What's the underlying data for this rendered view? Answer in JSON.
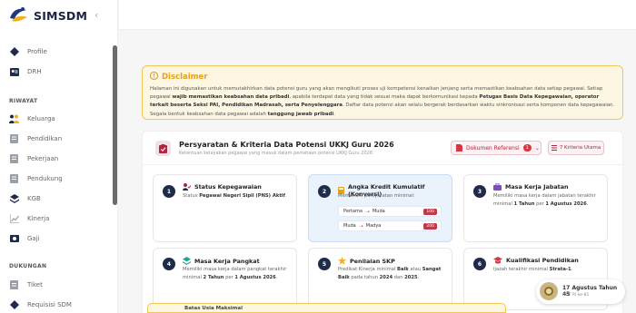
{
  "app": {
    "name": "SIMSDM"
  },
  "sidebar": {
    "items_top": [
      {
        "label": "Profile",
        "icon": "diamond-icon"
      },
      {
        "label": "DRH",
        "icon": "id-card-icon"
      }
    ],
    "section_riwayat": "RIWAYAT",
    "items_riwayat": [
      {
        "label": "Keluarga",
        "icon": "family-icon"
      },
      {
        "label": "Pendidikan",
        "icon": "document-icon"
      },
      {
        "label": "Pekerjaan",
        "icon": "document-icon"
      },
      {
        "label": "Pendukung",
        "icon": "document-icon"
      },
      {
        "label": "KGB",
        "icon": "layers-icon"
      },
      {
        "label": "Kinerja",
        "icon": "chart-icon"
      },
      {
        "label": "Gaji",
        "icon": "money-icon"
      }
    ],
    "section_dukungan": "DUKUNGAN",
    "items_dukungan": [
      {
        "label": "Tiket",
        "icon": "ticket-icon"
      },
      {
        "label": "Requisisi SDM",
        "icon": "diamond-icon"
      }
    ]
  },
  "disclaimer": {
    "title": "Disclaimer",
    "t1": "Halaman ini digunakan untuk memutakhirkan data potensi guru yang akan mengikuti proses uji kompetensi kenaikan jenjang serta memastikan keabsahan data setiap pegawai. Setiap pegawai ",
    "b1": "wajib memastikan keabsahan data pribadi",
    "t2": ", apabila terdapat data yang tidak sesuai maka dapat berkomunikasi kepada ",
    "b2": "Petugas Basis Data Kepegawaian, operator terkait beserta Seksi PAI, Pendidikan Madrasah, serta Penyelenggara",
    "t3": ". Daftar data potensi akan selalu bergerak berdasarkan waktu sinkronisasi serta komponen data kepegawaian. Segala bentuk keabsahan data pegawai adalah ",
    "b3": "tanggung jawab pribadi",
    "t4": "."
  },
  "requirements": {
    "title": "Persyaratan & Kriteria Data Potensi UKKJ Guru 2026",
    "subtitle": "Ketentuan kelayakan pegawai yang masuk dalam pemetaan potensi UKKJ Guru 2026",
    "ref_button": "Dokumen Referensi",
    "ref_badge": "1",
    "criteria_button": "7 Kriteria Utama"
  },
  "criteria": [
    {
      "num": "1",
      "title": "Status Kepegawaian",
      "d1": "Status ",
      "b1": "Pegawai Negeri Sipil (PNS) Aktif",
      "d2": "."
    },
    {
      "num": "2",
      "title": "Angka Kredit Kumulatif (Konversi)",
      "d1": "Memenuhi persyaratan minimal:",
      "rows": [
        {
          "from": "Pertama",
          "to": "Muda",
          "value": "100"
        },
        {
          "from": "Muda",
          "to": "Madya",
          "value": "200"
        }
      ]
    },
    {
      "num": "3",
      "title": "Masa Kerja Jabatan",
      "d1": "Memiliki masa kerja dalam jabatan terakhir minimal ",
      "b1": "1 Tahun",
      "d2": " per ",
      "b2": "1 Agustus 2026",
      "d3": "."
    },
    {
      "num": "4",
      "title": "Masa Kerja Pangkat",
      "d1": "Memiliki masa kerja dalam pangkat terakhir minimal ",
      "b1": "2 Tahun",
      "d2": " per ",
      "b2": "1 Agustus 2026",
      "d3": "."
    },
    {
      "num": "5",
      "title": "Penilaian SKP",
      "d1": "Predikat Kinerja minimal ",
      "b1": "Baik",
      "d2": " atau ",
      "b2": "Sangat Baik",
      "d3": " pada tahun ",
      "b3": "2024",
      "d4": " dan ",
      "b4": "2025",
      "d5": "."
    },
    {
      "num": "6",
      "title": "Kualifikasi Pendidikan",
      "d1": "Ijazah terakhir minimal ",
      "b1": "Strata-1",
      "d2": "."
    }
  ],
  "next_item": {
    "title": "Batas Usia Maksimal"
  },
  "toast": {
    "title": "17 Agustus Tahun 45",
    "subtitle": "HUT RI ke-81"
  },
  "colors": {
    "accent": "#b0263f",
    "navy": "#1f2b4a",
    "warning": "#e6a11a"
  }
}
